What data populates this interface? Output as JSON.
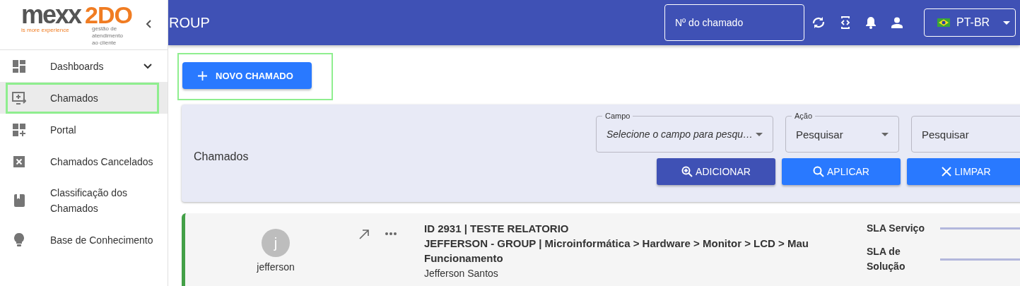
{
  "logo": {
    "brand": "mexx",
    "product": "2DO",
    "slogan": "is more experience",
    "tagline": [
      "gestão de",
      "atendimento",
      "ao cliente"
    ]
  },
  "sidebar": {
    "items": [
      {
        "label": "Dashboards",
        "expanded": false,
        "selected": false,
        "highlighted": false
      },
      {
        "label": "Chamados",
        "selected": true,
        "highlighted": true
      },
      {
        "label": "Portal",
        "selected": false,
        "highlighted": false
      },
      {
        "label": "Chamados Cancelados",
        "selected": false,
        "highlighted": false
      },
      {
        "label": "Classificação dos Chamados",
        "selected": false,
        "highlighted": false
      },
      {
        "label": "Base de Conhecimento",
        "selected": false,
        "highlighted": false
      }
    ]
  },
  "header": {
    "title": "ROUP",
    "ticket_search": {
      "placeholder": "Nº do chamado"
    },
    "language": {
      "label": "PT-BR"
    }
  },
  "new_ticket_button": {
    "label": "NOVO CHAMADO",
    "highlighted": true
  },
  "filter": {
    "title": "Chamados",
    "fields": [
      {
        "kind": "select",
        "label": "Campo",
        "placeholder": "Selecione o campo para pesqu…"
      },
      {
        "kind": "select",
        "label": "Ação",
        "value": "Pesquisar"
      },
      {
        "kind": "text",
        "placeholder": "Pesquisar"
      }
    ],
    "buttons": [
      {
        "label": "ADICIONAR",
        "color": "#3f51b5"
      },
      {
        "label": "APLICAR",
        "color": "#2979ff"
      },
      {
        "label": "LIMPAR",
        "color": "#2979ff"
      }
    ]
  },
  "tickets": [
    {
      "color": "#43a047",
      "initial": "j",
      "user": "jefferson",
      "title": "ID 2931 | TESTE RELATORIO",
      "path": "JEFFERSON - GROUP | Microinformática > Hardware > Monitor > LCD > Mau Funcionamento",
      "requester": "Jefferson Santos",
      "sla": [
        {
          "label": "SLA Serviço"
        },
        {
          "label": "SLA de Solução"
        }
      ]
    }
  ]
}
